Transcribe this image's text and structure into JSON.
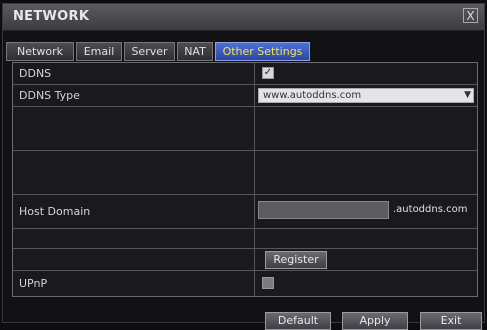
{
  "window": {
    "title": "NETWORK",
    "close_glyph": "X"
  },
  "tabs": [
    {
      "label": "Network",
      "active": false
    },
    {
      "label": "Email",
      "active": false
    },
    {
      "label": "Server",
      "active": false
    },
    {
      "label": "NAT",
      "active": false
    },
    {
      "label": "Other Settings",
      "active": true
    }
  ],
  "form": {
    "ddns_label": "DDNS",
    "ddns_checked": true,
    "ddns_type_label": "DDNS Type",
    "ddns_type_value": "www.autoddns.com",
    "host_domain_label": "Host Domain",
    "host_domain_value": "",
    "host_domain_suffix": ".autoddns.com",
    "register_label": "Register",
    "upnp_label": "UPnP",
    "upnp_checked": false
  },
  "footer": {
    "default_label": "Default",
    "apply_label": "Apply",
    "exit_label": "Exit"
  },
  "colors": {
    "active_tab": "#2b47a8",
    "active_tab_text": "#f2e34c",
    "background": "#121214"
  },
  "icons": {
    "close": "close-icon",
    "dropdown": "chevron-down-icon",
    "checkmark": "check-icon"
  }
}
